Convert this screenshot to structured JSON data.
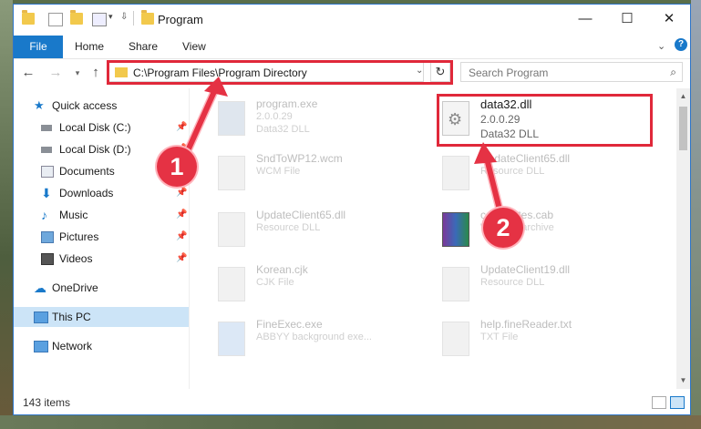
{
  "window": {
    "title": "Program",
    "controls": {
      "minimize": "—",
      "maximize": "☐",
      "close": "✕"
    }
  },
  "ribbon": {
    "tabs": [
      "File",
      "Home",
      "Share",
      "View"
    ]
  },
  "address_bar": {
    "path": "C:\\Program Files\\Program Directory",
    "search_placeholder": "Search Program"
  },
  "sidebar": {
    "items": [
      {
        "label": "Quick access",
        "icon": "star-icon"
      },
      {
        "label": "Local Disk (C:)",
        "icon": "drive-icon",
        "pinned": true
      },
      {
        "label": "Local Disk (D:)",
        "icon": "drive-icon",
        "pinned": true
      },
      {
        "label": "Documents",
        "icon": "documents-icon",
        "pinned": true
      },
      {
        "label": "Downloads",
        "icon": "download-icon",
        "pinned": true
      },
      {
        "label": "Music",
        "icon": "music-icon",
        "pinned": true
      },
      {
        "label": "Pictures",
        "icon": "pictures-icon",
        "pinned": true
      },
      {
        "label": "Videos",
        "icon": "videos-icon",
        "pinned": true
      },
      {
        "label": "OneDrive",
        "icon": "cloud-icon"
      },
      {
        "label": "This PC",
        "icon": "computer-icon",
        "selected": true
      },
      {
        "label": "Network",
        "icon": "network-icon"
      }
    ]
  },
  "files": [
    {
      "name": "program.exe",
      "line2": "2.0.0.29",
      "line3": "Data32 DLL"
    },
    {
      "name": "data32.dll",
      "line2": "2.0.0.29",
      "line3": "Data32 DLL",
      "selected": true
    },
    {
      "name": "SndToWP12.wcm",
      "line2": "WCM File",
      "line3": ""
    },
    {
      "name": "UpdateClient65.dll",
      "line2": "Resource DLL",
      "line3": ""
    },
    {
      "name": "UpdateClient65.dll",
      "line2": "Resource DLL",
      "line3": ""
    },
    {
      "name": "certificates.cab",
      "line2": "WinRAR archive",
      "line3": ""
    },
    {
      "name": "Korean.cjk",
      "line2": "CJK File",
      "line3": ""
    },
    {
      "name": "UpdateClient19.dll",
      "line2": "Resource DLL",
      "line3": ""
    },
    {
      "name": "FineExec.exe",
      "line2": "ABBYY background exe...",
      "line3": ""
    },
    {
      "name": "help.fineReader.txt",
      "line2": "TXT File",
      "line3": ""
    }
  ],
  "status": {
    "item_count": "143 items"
  },
  "callouts": {
    "first": "1",
    "second": "2"
  },
  "colors": {
    "accent": "#1979ca",
    "highlight": "#e0283a",
    "selection": "#cce4f7"
  }
}
